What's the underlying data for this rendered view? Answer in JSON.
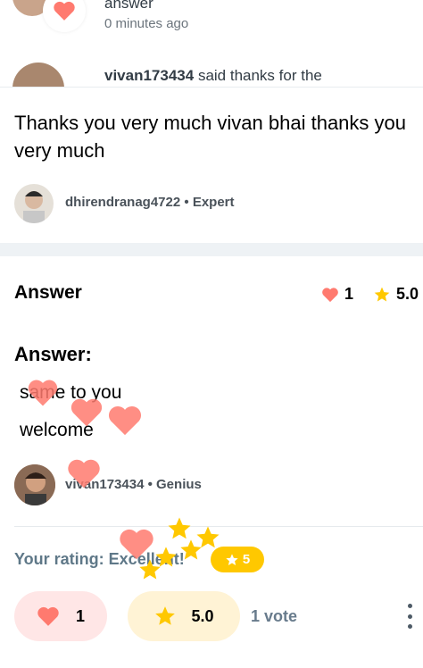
{
  "notifications": [
    {
      "text": "answer",
      "time": "0 minutes ago"
    },
    {
      "user": "vivan173434",
      "action": "said thanks for the"
    }
  ],
  "comment": {
    "text": "Thanks you very much vivan bhai thanks you very much",
    "author": "dhirendranag4722",
    "rank": "Expert"
  },
  "answer": {
    "heading": "Answer",
    "likes": "1",
    "rating": "5.0",
    "label": "Answer:",
    "line1": "same to you",
    "line2": "welcome",
    "author": "vivan173434",
    "rank": "Genius"
  },
  "your_rating": {
    "label": "Your rating: Excellent!",
    "value": "5"
  },
  "actions": {
    "like_count": "1",
    "rating": "5.0",
    "votes": "1 vote"
  },
  "colors": {
    "heart": "#ff7a6f",
    "star": "#ffc800",
    "rating_label": "#5f7888"
  }
}
